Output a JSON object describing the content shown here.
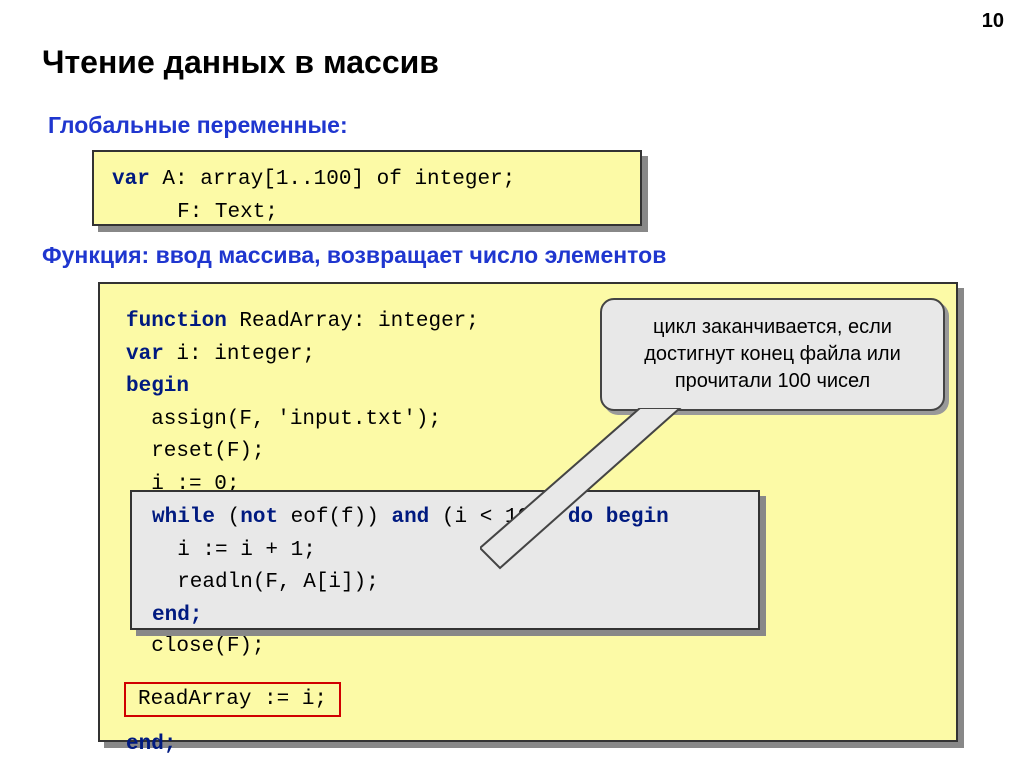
{
  "page_number": "10",
  "title": "Чтение данных в массив",
  "subtitle_globals": "Глобальные переменные:",
  "subtitle_func": "Функция: ввод массива, возвращает число элементов",
  "code1": {
    "kw_var": "var",
    "line1_rest": " A: array[1..100] of integer;",
    "line2": "F: Text;"
  },
  "callout_text": "цикл заканчивается, если достигнут конец файла или прочитали 100 чисел",
  "code2": {
    "l1a": "function",
    "l1b": " ReadArray: integer;",
    "l2a": "var",
    "l2b": " i: integer;",
    "l3": "begin",
    "l4": "  assign(F, 'input.txt');",
    "l5": "  reset(F);",
    "l6": "  i := 0;",
    "l_after_close": "  close(F);",
    "l_end": "end;"
  },
  "inner": {
    "l1a": "while",
    "l1b": " (",
    "l1c": "not",
    "l1d": " eof(f)) ",
    "l1e": "and",
    "l1f": " (i < 100) ",
    "l1g": "do begin",
    "l2": "  i := i + 1;",
    "l3": "  readln(F, A[i]);",
    "l4": "end;"
  },
  "redbox_text": "ReadArray := i;"
}
